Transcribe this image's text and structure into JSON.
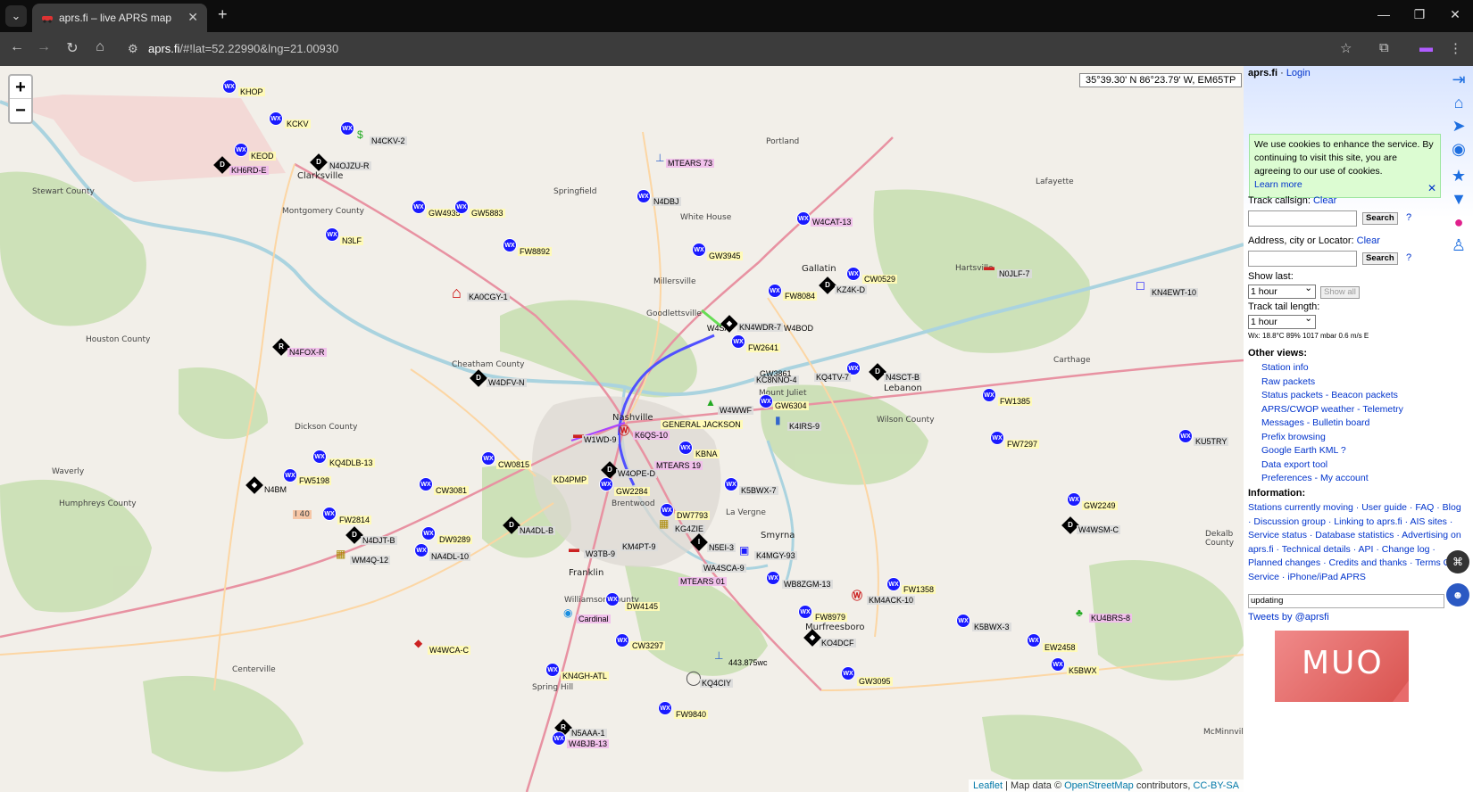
{
  "browser": {
    "tab_title": "aprs.fi – live APRS map",
    "url_domain": "aprs.fi",
    "url_rest": "/#!lat=52.22990&lng=21.00930"
  },
  "map": {
    "coords_readout": "35°39.30' N 86°23.79' W, EM65TP",
    "zoom_in": "+",
    "zoom_out": "−",
    "attribution": {
      "leaflet": "Leaflet",
      "data": "| Map data ©",
      "osm": "OpenStreetMap",
      "contrib": "contributors,",
      "license": "CC-BY-SA"
    },
    "places": [
      {
        "name": "Clarksville",
        "city": true
      },
      {
        "name": "Springfield"
      },
      {
        "name": "Portland"
      },
      {
        "name": "White House"
      },
      {
        "name": "Gallatin",
        "city": true
      },
      {
        "name": "Lafayette"
      },
      {
        "name": "Hartsville"
      },
      {
        "name": "Millersville"
      },
      {
        "name": "Goodlettsville"
      },
      {
        "name": "Houston County"
      },
      {
        "name": "Cheatham County"
      },
      {
        "name": "Montgomery County"
      },
      {
        "name": "Stewart County"
      },
      {
        "name": "Carthage"
      },
      {
        "name": "Mount Juliet"
      },
      {
        "name": "Lebanon",
        "city": true
      },
      {
        "name": "Wilson County"
      },
      {
        "name": "Nashville",
        "city": true
      },
      {
        "name": "Dickson County"
      },
      {
        "name": "Waverly"
      },
      {
        "name": "Humphreys County"
      },
      {
        "name": "Brentwood"
      },
      {
        "name": "La Vergne"
      },
      {
        "name": "Smyrna",
        "city": true
      },
      {
        "name": "Franklin",
        "city": true
      },
      {
        "name": "Williamson County"
      },
      {
        "name": "Murfreesboro",
        "city": true
      },
      {
        "name": "Centerville"
      },
      {
        "name": "Spring Hill"
      },
      {
        "name": "Dekalb County"
      },
      {
        "name": "McMinnville"
      },
      {
        "name": "I 40"
      }
    ],
    "stations": [
      "KHOP",
      "KCKV",
      "N4CKV-2",
      "KEOD",
      "N4OJZU-R",
      "KH6RD-E",
      "GW4935",
      "GW5883",
      "N3LF",
      "MTEARS 73",
      "N4DBJ",
      "W4CAT-13",
      "GW3945",
      "FW8892",
      "KA0CGY-1",
      "N4FOX-R",
      "W4DFV-N",
      "N0JLF-7",
      "KN4EWT-10",
      "CW0529",
      "FW8084",
      "KZ4K-D",
      "N4SCT-B",
      "KC8NNO-4",
      "GW3861",
      "KQ4TV-7",
      "KN4WDR-7",
      "FW2641",
      "GW6304",
      "W4WWF",
      "K4IRS-9",
      "FW1385",
      "FW7297",
      "KU5TRY",
      "W1WD-9",
      "K6QS-10",
      "GENERAL JACKSON",
      "KBNA",
      "W4OPE-D",
      "MTEARS 19",
      "KD4PMP",
      "CW0815",
      "CW3081",
      "GW2284",
      "KQ4DLB-13",
      "FW5198",
      "N4BM",
      "FW2814",
      "N4DJT-B",
      "WM4Q-12",
      "DW9289",
      "NA4DL-10",
      "NA4DL-B",
      "DW7793",
      "KG4ZIE",
      "K5BWX-7",
      "W3TB-9",
      "KM4PT-9",
      "N5EI-3",
      "K4MGY-93",
      "WA4SCA-9",
      "MTEARS 01",
      "WB8ZGM-13",
      "GW2249",
      "W4WSM-C",
      "KM4ACK-10",
      "FW1358",
      "FW8979",
      "KO4DCF",
      "K5BWX-3",
      "KU4BRS-8",
      "CW3297",
      "DW4145",
      "Cardinal",
      "W4WCA-C",
      "443.875wc",
      "KQ4CIY",
      "GW3095",
      "EW2458",
      "K5BWX",
      "KN4GH-ATL",
      "FW9840",
      "N5AAA-1",
      "W4BJB-13",
      "W4SA",
      "W4BOD"
    ]
  },
  "sidebar": {
    "brand": "aprs.fi",
    "sep": "·",
    "login": "Login",
    "cookie": {
      "text": "We use cookies to enhance the service. By continuing to visit this site, you are agreeing to our use of cookies.",
      "learn_more": "Learn more",
      "close": "✕"
    },
    "track": {
      "label": "Track callsign:",
      "clear": "Clear",
      "search": "Search",
      "help": "?"
    },
    "address": {
      "label": "Address, city or Locator:",
      "clear": "Clear",
      "search": "Search",
      "help": "?"
    },
    "show_last": {
      "label": "Show last:",
      "value": "1 hour",
      "show_all": "Show all"
    },
    "tail": {
      "label": "Track tail length:",
      "value": "1 hour"
    },
    "wx_line": "Wx: 18.8°C 89% 1017 mbar 0.6 m/s E",
    "other_views_title": "Other views:",
    "other_views": [
      "Station info",
      "Raw packets",
      "Status packets - Beacon packets",
      "APRS/CWOP weather - Telemetry",
      "Messages - Bulletin board",
      "Prefix browsing",
      "Google Earth KML ?",
      "Data export tool",
      "Preferences - My account"
    ],
    "information_title": "Information:",
    "information_text": "Stations currently moving · User guide · FAQ · Blog · Discussion group · Linking to aprs.fi · AIS sites · Service status · Database statistics · Advertising on aprs.fi · Technical details · API · Change log · Planned changes · Credits and thanks · Terms Of Service · iPhone/iPad APRS",
    "status_value": "updating",
    "tweets": "Tweets by @aprsfi",
    "watermark": "MUO"
  }
}
